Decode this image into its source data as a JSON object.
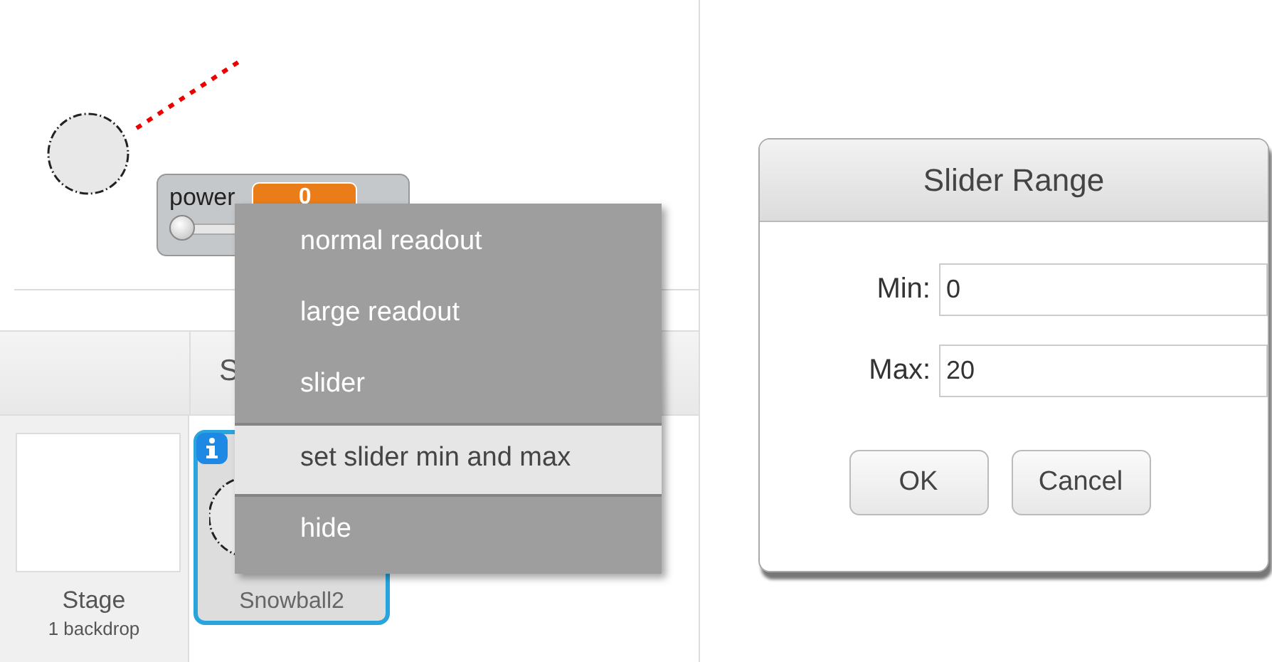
{
  "stage": {
    "monitor": {
      "label": "power",
      "value": "0",
      "level": 0
    }
  },
  "sprites_pane": {
    "header": "S",
    "stage_tile": {
      "name": "Stage",
      "info": "1 backdrop"
    },
    "sprites": [
      {
        "name": "Snowball2",
        "selected": true
      }
    ]
  },
  "context_menu": {
    "items": [
      {
        "label": "normal readout",
        "selected": false
      },
      {
        "label": "large readout",
        "selected": false
      },
      {
        "label": "slider",
        "selected": false
      },
      {
        "label": "set slider min and max",
        "selected": true
      },
      {
        "label": "hide",
        "selected": false
      }
    ]
  },
  "dialog": {
    "title": "Slider Range",
    "fields": [
      {
        "label": "Min:",
        "value": "0"
      },
      {
        "label": "Max:",
        "value": "20"
      }
    ],
    "buttons": [
      "OK",
      "Cancel"
    ]
  }
}
